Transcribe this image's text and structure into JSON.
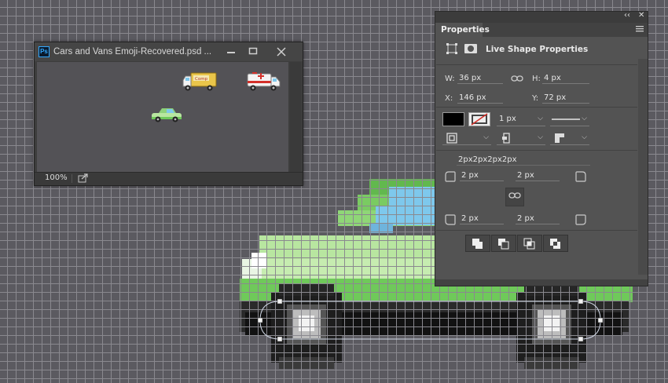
{
  "document_window": {
    "app_icon": "Ps",
    "title": "Cars and Vans Emoji-Recovered.psd ...",
    "zoom": "100%",
    "controls": {
      "minimize_icon": "minimize-icon",
      "maximize_icon": "maximize-icon",
      "close_icon": "close-icon"
    },
    "thumbnails": {
      "truck_label": "Comp",
      "icons": [
        "delivery-truck-icon",
        "ambulance-icon",
        "green-car-icon"
      ]
    }
  },
  "properties_panel": {
    "tab_title": "Properties",
    "collapse_glyph": "‹‹",
    "close_glyph": "✕",
    "section_title": "Live Shape Properties",
    "transform": {
      "w_label": "W:",
      "w_value": "36 px",
      "h_label": "H:",
      "h_value": "4 px",
      "x_label": "X:",
      "x_value": "146 px",
      "y_label": "Y:",
      "y_value": "72 px"
    },
    "stroke": {
      "fill_color": "#000000",
      "stroke_width": "1 px"
    },
    "corners": {
      "summary": "2px2px2px2px",
      "top_left": "2 px",
      "top_right": "2 px",
      "bottom_left": "2 px",
      "bottom_right": "2 px"
    },
    "path_ops": [
      "combine-shapes-icon",
      "subtract-front-shape-icon",
      "intersect-shape-areas-icon",
      "exclude-overlapping-shapes-icon"
    ]
  },
  "colors": {
    "canvas_bg": "#5b5a60",
    "grid_line": "#8a898f",
    "panel_bg": "#535353",
    "car_green_light": "#b8e6a0",
    "car_green": "#6fc95a",
    "car_window": "#7ec8ec",
    "tire_dark": "#1e1e1e"
  }
}
